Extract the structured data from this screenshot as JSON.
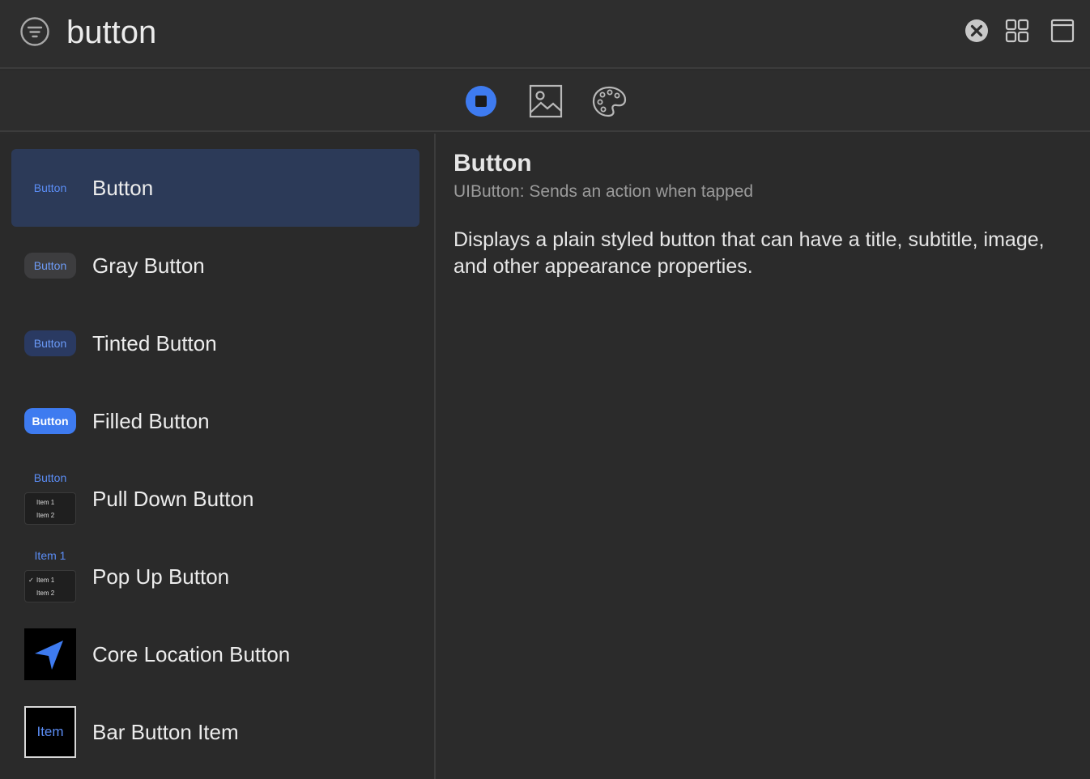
{
  "search": {
    "value": "button",
    "filter_icon": "filter-circle-icon",
    "clear_icon": "clear-circle-icon",
    "grid_icon": "grid-view-icon",
    "window_icon": "window-icon"
  },
  "library_tabs": [
    {
      "name": "objects",
      "icon": "objects-square-circle-icon",
      "selected": true
    },
    {
      "name": "media",
      "icon": "photo-icon",
      "selected": false
    },
    {
      "name": "colors",
      "icon": "palette-icon",
      "selected": false
    }
  ],
  "items": [
    {
      "label": "Button",
      "thumb_text": "Button",
      "selected": true
    },
    {
      "label": "Gray Button",
      "thumb_text": "Button"
    },
    {
      "label": "Tinted Button",
      "thumb_text": "Button"
    },
    {
      "label": "Filled Button",
      "thumb_text": "Button"
    },
    {
      "label": "Pull Down Button",
      "thumb_text": "Button",
      "menu": [
        "Item 1",
        "Item 2"
      ]
    },
    {
      "label": "Pop Up Button",
      "thumb_text": "Item 1",
      "menu": [
        "Item 1",
        "Item 2"
      ],
      "check": "✓"
    },
    {
      "label": "Core Location Button",
      "thumb_icon": "location-arrow-icon"
    },
    {
      "label": "Bar Button Item",
      "thumb_text": "Item"
    }
  ],
  "detail": {
    "title": "Button",
    "subtitle": "UIButton: Sends an action when tapped",
    "description": "Displays a plain styled button that can have a title, subtitle, image, and other appearance properties."
  },
  "colors": {
    "accent": "#3e7bf0",
    "selection": "#2c3a58",
    "background": "#2b2b2b"
  }
}
